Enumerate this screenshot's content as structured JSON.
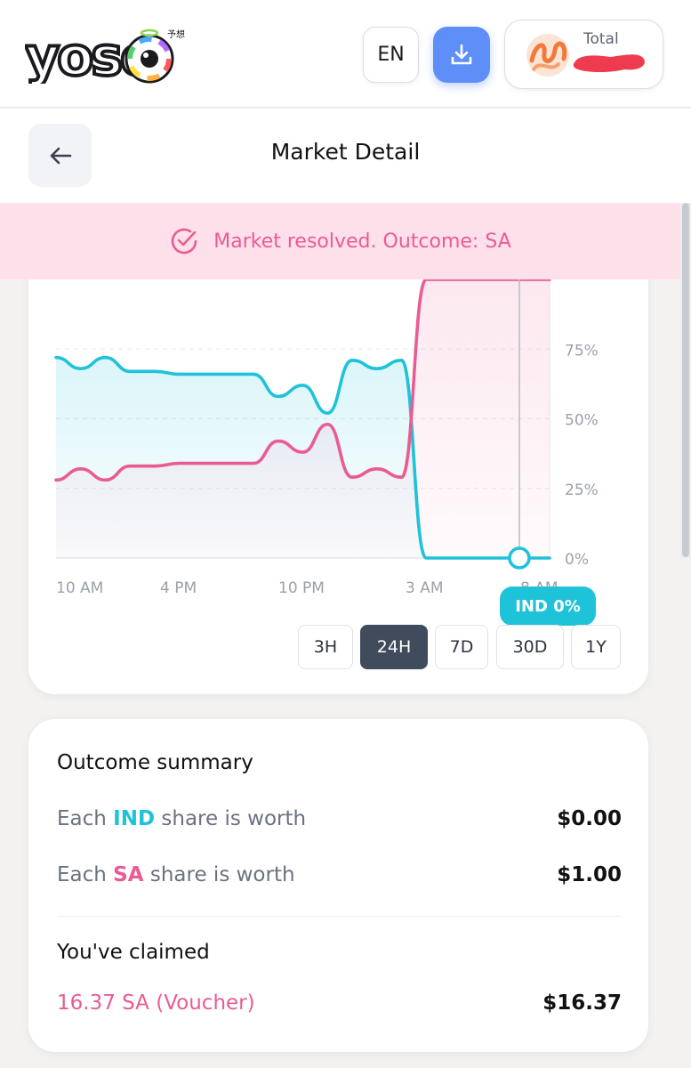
{
  "header": {
    "logo_text": "yoso",
    "logo_subtext": "予想",
    "language": "EN",
    "balance_label": "Total"
  },
  "titlebar": {
    "title": "Market Detail"
  },
  "banner": {
    "text": "Market resolved. Outcome: SA"
  },
  "colors": {
    "ind": "#1ec2d9",
    "sa": "#ea5b94",
    "accent": "#5e8ef7",
    "active_range": "#404b5c"
  },
  "chart": {
    "tooltip": "IND 0%",
    "range_buttons": [
      {
        "label": "3H",
        "active": false
      },
      {
        "label": "24H",
        "active": true
      },
      {
        "label": "7D",
        "active": false
      },
      {
        "label": "30D",
        "active": false
      },
      {
        "label": "1Y",
        "active": false
      }
    ]
  },
  "chart_data": {
    "type": "line",
    "x_ticks": [
      "10 AM",
      "4 PM",
      "10 PM",
      "3 AM",
      "8 AM"
    ],
    "y_ticks": [
      "0%",
      "25%",
      "50%",
      "75%"
    ],
    "ylim": [
      0,
      100
    ],
    "grid": true,
    "series": [
      {
        "name": "IND",
        "color": "#1ec2d9",
        "values": [
          72,
          68,
          72,
          67,
          67,
          66,
          66,
          66,
          66,
          58,
          62,
          52,
          71,
          68,
          71,
          0,
          0,
          0,
          0,
          0,
          0
        ]
      },
      {
        "name": "SA",
        "color": "#ea5b94",
        "values": [
          28,
          32,
          28,
          33,
          33,
          34,
          34,
          34,
          34,
          42,
          38,
          48,
          29,
          32,
          29,
          100,
          100,
          100,
          100,
          100,
          100
        ]
      }
    ]
  },
  "summary": {
    "title": "Outcome summary",
    "rows": [
      {
        "prefix": "Each ",
        "outcome": "IND",
        "suffix": " share is worth",
        "value": "$0.00"
      },
      {
        "prefix": "Each ",
        "outcome": "SA",
        "suffix": " share is worth",
        "value": "$1.00"
      }
    ],
    "claimed_label": "You've claimed",
    "claimed_detail": "16.37 SA (Voucher)",
    "claimed_value": "$16.37"
  }
}
